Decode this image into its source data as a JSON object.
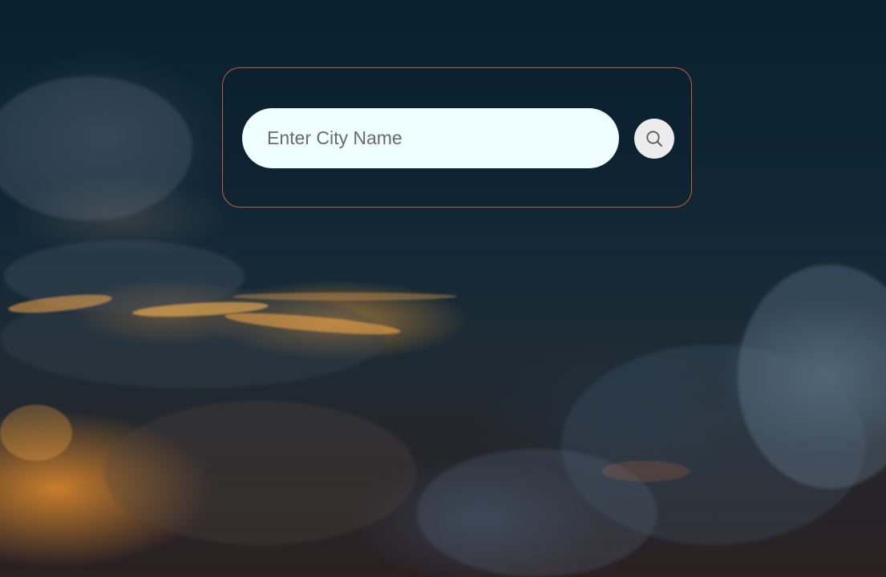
{
  "search": {
    "placeholder": "Enter City Name",
    "button_icon": "search-icon"
  },
  "theme": {
    "panel_border": "#d8673e",
    "input_background": "#efffff",
    "button_background": "#ececec"
  }
}
